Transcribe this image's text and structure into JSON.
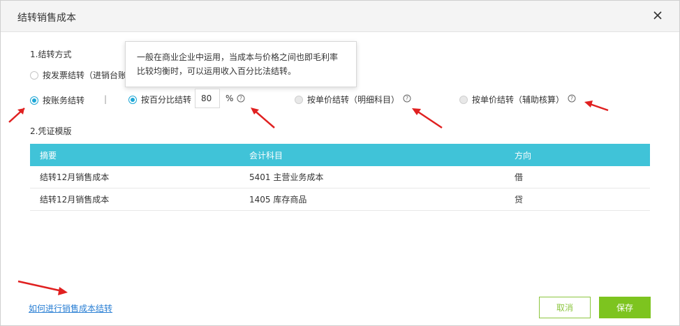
{
  "dialog": {
    "title": "结转销售成本",
    "close_label": "×"
  },
  "section1": {
    "title": "1.结转方式",
    "option_invoice": "按发票结转（进销台账",
    "option_account": "按账务结转",
    "separator": "|",
    "option_percent": "按百分比结转",
    "percent_value": "80",
    "percent_unit": "%",
    "option_unit_price_detail": "按单价结转（明细科目）",
    "option_unit_price_aux": "按单价结转（辅助核算）"
  },
  "tooltip": {
    "text": "一般在商业企业中运用，当成本与价格之间也即毛利率比较均衡时，可以运用收入百分比法结转。"
  },
  "section2": {
    "title": "2.凭证模版",
    "columns": [
      "摘要",
      "会计科目",
      "方向"
    ],
    "rows": [
      [
        "结转12月销售成本",
        "5401 主营业务成本",
        "借"
      ],
      [
        "结转12月销售成本",
        "1405 库存商品",
        "贷"
      ]
    ]
  },
  "footer": {
    "help_link": "如何进行销售成本结转",
    "cancel_label": "取消",
    "save_label": "保存"
  },
  "colors": {
    "accent": "#1ea7d6",
    "table_header": "#40c3d8",
    "save_button": "#7dc41f",
    "annotation_arrow": "#e02020"
  },
  "icons": {
    "close": "close-icon",
    "help": "question-circle-icon",
    "arrow": "annotation-arrow"
  }
}
